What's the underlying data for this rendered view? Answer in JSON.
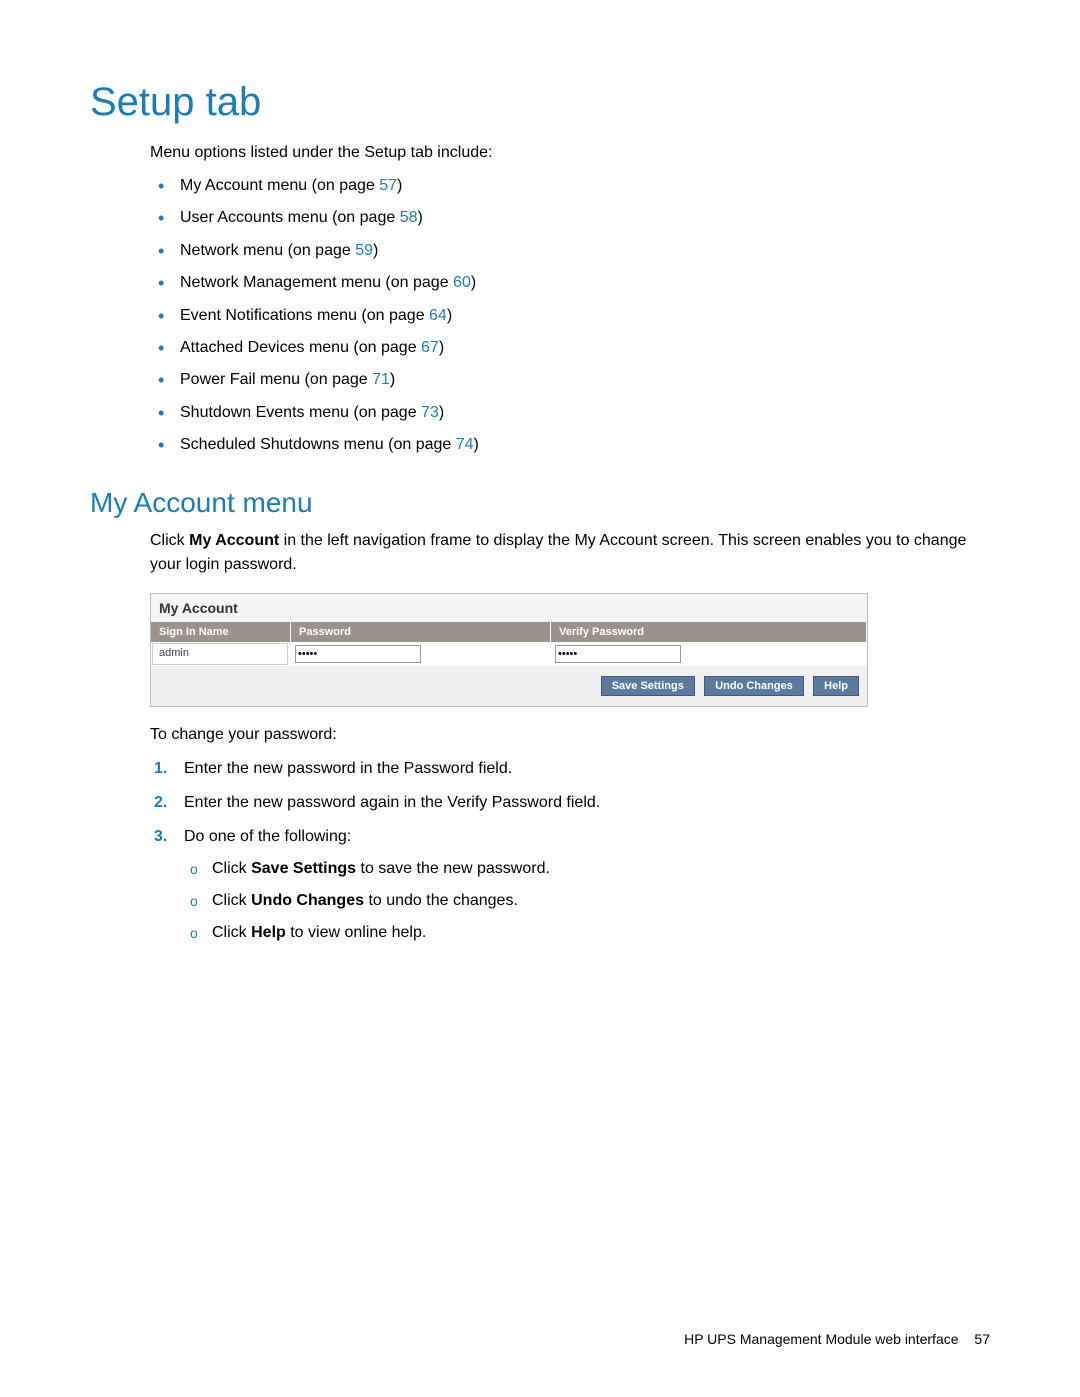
{
  "headings": {
    "setup_tab": "Setup tab",
    "my_account_menu": "My Account menu"
  },
  "intro": "Menu options listed under the Setup tab include:",
  "menu_items": [
    {
      "label": "My Account menu (on page ",
      "page": "57",
      "after": ")"
    },
    {
      "label": "User Accounts menu (on page ",
      "page": "58",
      "after": ")"
    },
    {
      "label": "Network menu (on page ",
      "page": "59",
      "after": ")"
    },
    {
      "label": "Network Management menu (on page ",
      "page": "60",
      "after": ")"
    },
    {
      "label": "Event Notifications menu (on page ",
      "page": "64",
      "after": ")"
    },
    {
      "label": "Attached Devices menu (on page ",
      "page": "67",
      "after": ")"
    },
    {
      "label": "Power Fail menu (on page ",
      "page": "71",
      "after": ")"
    },
    {
      "label": "Shutdown Events menu (on page ",
      "page": "73",
      "after": ")"
    },
    {
      "label": "Scheduled Shutdowns menu (on page ",
      "page": "74",
      "after": ")"
    }
  ],
  "my_account_para": {
    "pre": "Click ",
    "bold": "My Account",
    "post": " in the left navigation frame to display the My Account screen. This screen enables you to change your login password."
  },
  "ui": {
    "title": "My Account",
    "headers": {
      "sign": "Sign In Name",
      "pass": "Password",
      "verify": "Verify Password"
    },
    "row": {
      "sign_value": "admin",
      "pass_value": "•••••",
      "verify_value": "•••••"
    },
    "buttons": {
      "save": "Save Settings",
      "undo": "Undo Changes",
      "help": "Help"
    }
  },
  "change_intro": "To change your password:",
  "steps": {
    "s1": "Enter the new password in the Password field.",
    "s2": "Enter the new password again in the Verify Password field.",
    "s3": "Do one of the following:"
  },
  "substeps": {
    "a_pre": "Click ",
    "a_bold": "Save Settings",
    "a_post": " to save the new password.",
    "b_pre": "Click ",
    "b_bold": "Undo Changes",
    "b_post": " to undo the changes.",
    "c_pre": "Click ",
    "c_bold": "Help",
    "c_post": " to view online help."
  },
  "footer": {
    "text": "HP UPS Management Module web interface",
    "page": "57"
  }
}
